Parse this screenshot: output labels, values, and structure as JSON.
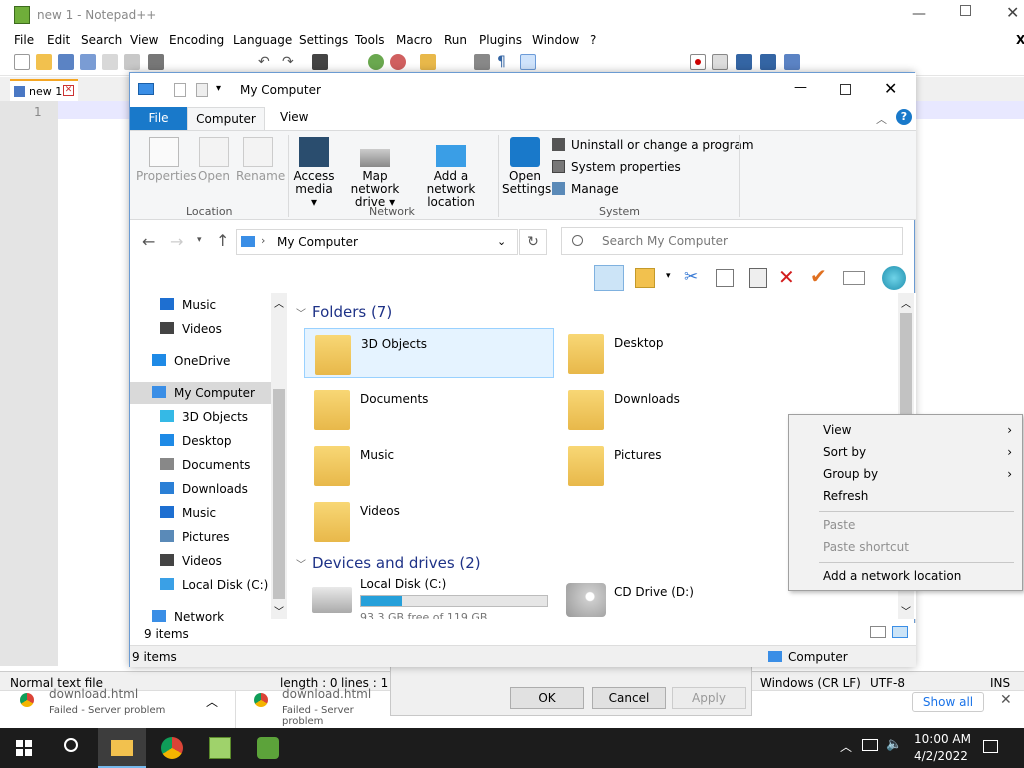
{
  "notepad": {
    "title": "new 1 - Notepad++",
    "menu": [
      "File",
      "Edit",
      "Search",
      "View",
      "Encoding",
      "Language",
      "Settings",
      "Tools",
      "Macro",
      "Run",
      "Plugins",
      "Window",
      "?"
    ],
    "tab": "new 1",
    "line_number": "1",
    "status": {
      "type": "Normal text file",
      "length": "length : 0",
      "lines": "lines : 1",
      "eol": "Windows (CR LF)",
      "enc": "UTF-8",
      "mode": "INS"
    },
    "close_x": "X"
  },
  "explorer": {
    "title": "My Computer",
    "tabs": {
      "file": "File",
      "computer": "Computer",
      "view": "View"
    },
    "ribbon": {
      "properties": "Properties",
      "open": "Open",
      "rename": "Rename",
      "access_media_1": "Access",
      "access_media_2": "media",
      "map_drive_1": "Map network",
      "map_drive_2": "drive",
      "add_loc_1": "Add a network",
      "add_loc_2": "location",
      "open_settings_1": "Open",
      "open_settings_2": "Settings",
      "uninstall": "Uninstall or change a program",
      "sysprops": "System properties",
      "manage": "Manage",
      "group_location": "Location",
      "group_network": "Network",
      "group_system": "System"
    },
    "address": "My Computer",
    "search_placeholder": "Search My Computer",
    "nav": [
      {
        "label": "Music",
        "color": "#1e6fd1"
      },
      {
        "label": "Videos",
        "color": "#444"
      },
      {
        "label": "OneDrive",
        "color": "#1e8ae6"
      },
      {
        "label": "My Computer",
        "color": "#3a8ee6"
      },
      {
        "label": "3D Objects",
        "color": "#35b9e6"
      },
      {
        "label": "Desktop",
        "color": "#1e8ae6"
      },
      {
        "label": "Documents",
        "color": "#888"
      },
      {
        "label": "Downloads",
        "color": "#2a7fd6"
      },
      {
        "label": "Music",
        "color": "#1e6fd1"
      },
      {
        "label": "Pictures",
        "color": "#5a8ab8"
      },
      {
        "label": "Videos",
        "color": "#444"
      },
      {
        "label": "Local Disk (C:)",
        "color": "#3aa0e6"
      },
      {
        "label": "Network",
        "color": "#3a8ee6"
      }
    ],
    "folders_header": "Folders (7)",
    "folders": [
      "3D Objects",
      "Desktop",
      "Documents",
      "Downloads",
      "Music",
      "Pictures",
      "Videos"
    ],
    "devices_header": "Devices and drives (2)",
    "drives": {
      "c_label": "Local Disk (C:)",
      "c_free": "93.3 GB free of 119 GB",
      "c_used_fraction": 0.22,
      "d_label": "CD Drive (D:)"
    },
    "items_count": "9 items",
    "status_items": "9 items",
    "status_location": "Computer"
  },
  "context_menu": {
    "view": "View",
    "sort_by": "Sort by",
    "group_by": "Group by",
    "refresh": "Refresh",
    "paste": "Paste",
    "paste_shortcut": "Paste shortcut",
    "add_network_location": "Add a network location"
  },
  "dialog": {
    "ok": "OK",
    "cancel": "Cancel",
    "apply": "Apply"
  },
  "downloads": [
    {
      "name": "download.html",
      "status": "Failed - Server problem"
    },
    {
      "name": "download.html",
      "status": "Failed - Server problem"
    }
  ],
  "show_all": "Show all",
  "taskbar": {
    "time": "10:00 AM",
    "date": "4/2/2022"
  }
}
